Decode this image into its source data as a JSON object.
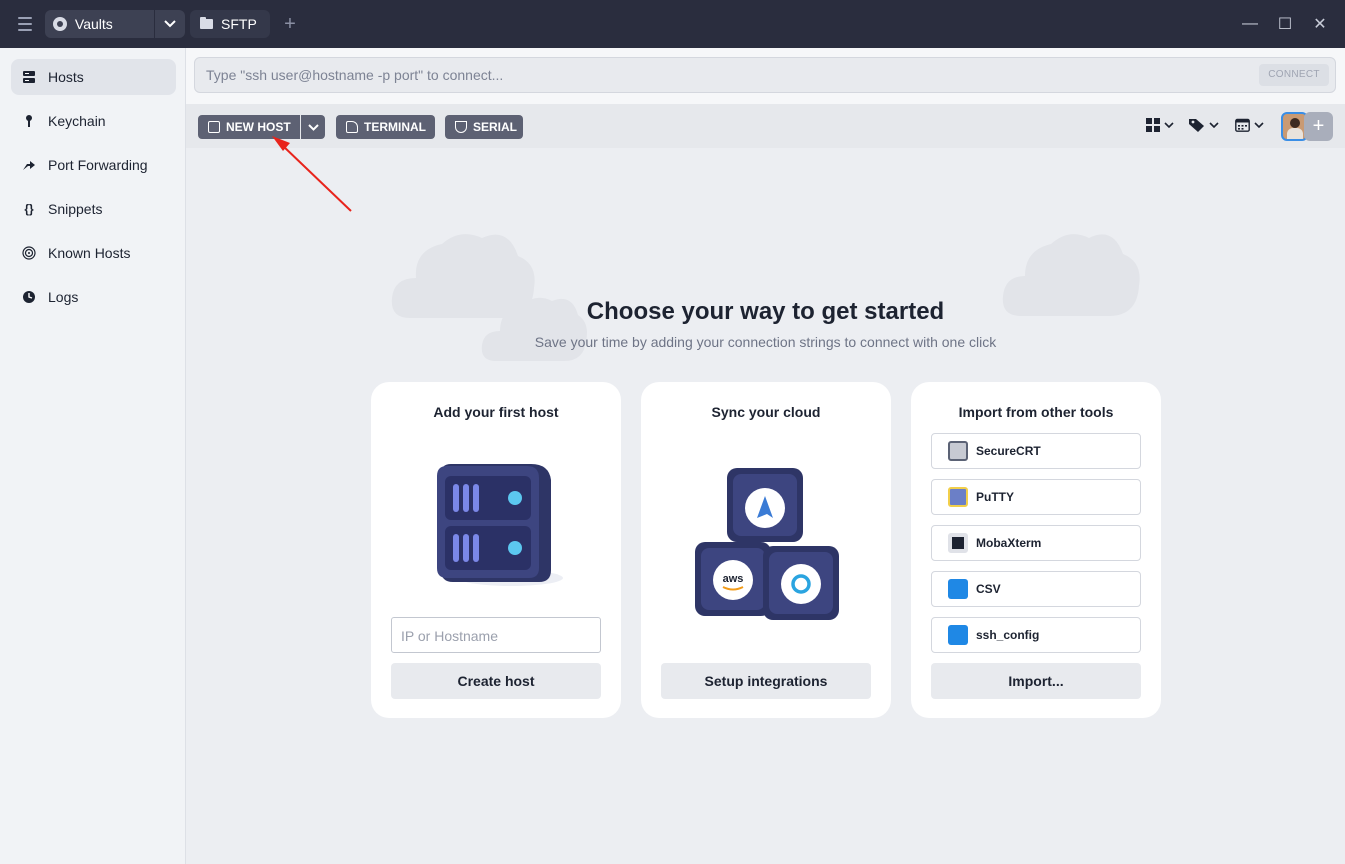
{
  "titlebar": {
    "vault_label": "Vaults",
    "sftp_label": "SFTP",
    "add_tab": "+",
    "minimize": "—",
    "maximize": "☐",
    "close": "✕"
  },
  "sidebar": {
    "items": [
      {
        "label": "Hosts",
        "icon": "server-icon",
        "active": true
      },
      {
        "label": "Keychain",
        "icon": "key-icon",
        "active": false
      },
      {
        "label": "Port Forwarding",
        "icon": "forward-icon",
        "active": false
      },
      {
        "label": "Snippets",
        "icon": "braces-icon",
        "active": false
      },
      {
        "label": "Known Hosts",
        "icon": "fingerprint-icon",
        "active": false
      },
      {
        "label": "Logs",
        "icon": "clock-icon",
        "active": false
      }
    ]
  },
  "connect": {
    "placeholder": "Type \"ssh user@hostname -p port\" to connect...",
    "button": "CONNECT"
  },
  "toolbar": {
    "new_host": "NEW HOST",
    "terminal": "TERMINAL",
    "serial": "SERIAL"
  },
  "main": {
    "headline": "Choose your way to get started",
    "subline": "Save your time by adding your connection strings to connect with one click"
  },
  "cards": {
    "host": {
      "title": "Add your first host",
      "input_placeholder": "IP or Hostname",
      "button": "Create host"
    },
    "cloud": {
      "title": "Sync your cloud",
      "button": "Setup integrations"
    },
    "import": {
      "title": "Import from other tools",
      "tools": [
        "SecureCRT",
        "PuTTY",
        "MobaXterm",
        "CSV",
        "ssh_config"
      ],
      "button": "Import..."
    }
  },
  "colors": {
    "titlebar": "#2a2d3e",
    "button_dark": "#5d6173",
    "annotation_arrow": "#e8241c",
    "avatar_border": "#3a8ee6"
  }
}
